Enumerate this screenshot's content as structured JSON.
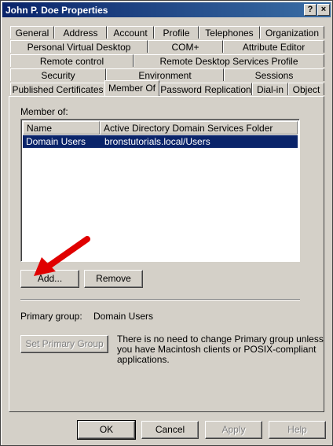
{
  "window": {
    "title": "John P. Doe Properties"
  },
  "titlebar_buttons": {
    "help": "?",
    "close": "×"
  },
  "tabs": {
    "row1": [
      "General",
      "Address",
      "Account",
      "Profile",
      "Telephones",
      "Organization"
    ],
    "row2": [
      "Personal Virtual Desktop",
      "COM+",
      "Attribute Editor"
    ],
    "row3": [
      "Remote control",
      "Remote Desktop Services Profile"
    ],
    "row4": [
      "Security",
      "Environment",
      "Sessions"
    ],
    "row5": [
      "Published Certificates",
      "Member Of",
      "Password Replication",
      "Dial-in",
      "Object"
    ],
    "active": "Member Of"
  },
  "member_of": {
    "label": "Member of:",
    "columns": [
      "Name",
      "Active Directory Domain Services Folder"
    ],
    "rows": [
      {
        "name": "Domain Users",
        "folder": "bronstutorials.local/Users",
        "selected": true
      }
    ]
  },
  "buttons": {
    "add": "Add...",
    "remove": "Remove",
    "set_primary": "Set Primary Group"
  },
  "primary_group": {
    "label": "Primary group:",
    "value": "Domain Users",
    "note_line1": "There is no need to change Primary group unless",
    "note_line2": "you have Macintosh clients or POSIX-compliant",
    "note_line3": "applications."
  },
  "footer": {
    "ok": "OK",
    "cancel": "Cancel",
    "apply": "Apply",
    "help": "Help"
  },
  "colors": {
    "selection": "#0a246a",
    "titlebar": "#0a246a",
    "arrow": "#e00000"
  },
  "icons": {
    "annotation": "red-arrow-icon"
  }
}
